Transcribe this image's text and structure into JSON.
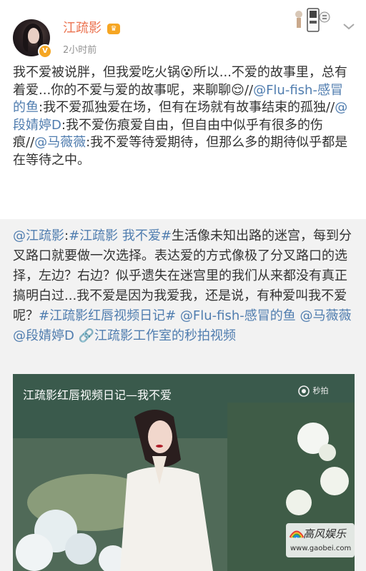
{
  "post": {
    "username": "江疏影",
    "timestamp": "2小时前",
    "text_parts": [
      {
        "t": "我不爱被说胖，但我爱吃火锅",
        "link": false
      },
      {
        "t": "😵",
        "link": false
      },
      {
        "t": "所以...不爱的故事里，总有着爱...你的不爱与爱的故事呢，来聊聊",
        "link": false
      },
      {
        "t": "😌",
        "link": false
      },
      {
        "t": "//",
        "link": false
      },
      {
        "t": "@Flu-fish-感冒的鱼",
        "link": true
      },
      {
        "t": ":我不爱孤独爱在场，但有在场就有故事结束的孤独//",
        "link": false
      },
      {
        "t": "@段婧婷D",
        "link": true
      },
      {
        "t": ":我不爱伤痕爱自由，但自由中似乎有很多的伤痕//",
        "link": false
      },
      {
        "t": "@马薇薇",
        "link": true
      },
      {
        "t": ":我不爱等待爱期待，但那么多的期待似乎都是在等待之中。",
        "link": false
      }
    ]
  },
  "repost": {
    "text_parts": [
      {
        "t": "@江疏影",
        "link": true
      },
      {
        "t": ":",
        "link": false
      },
      {
        "t": "#江疏影 我不爱#",
        "link": true
      },
      {
        "t": "生活像未知出路的迷宫，每到分叉路口就要做一次选择。表达爱的方式像极了分叉路口的选择，左边？右边？似乎遗失在迷宫里的我们从来都没有真正搞明白过...我不爱是因为我爱我，还是说，有种爱叫我不爱呢？",
        "link": false
      },
      {
        "t": "#江疏影红唇视频日记#",
        "link": true
      },
      {
        "t": " ",
        "link": false
      },
      {
        "t": "@Flu-fish-感冒的鱼",
        "link": true
      },
      {
        "t": " ",
        "link": false
      },
      {
        "t": "@马薇薇",
        "link": true
      },
      {
        "t": " ",
        "link": false
      },
      {
        "t": "@段婧婷D",
        "link": true
      },
      {
        "t": " ",
        "link": false
      },
      {
        "t": "🔗江疏影工作室的秒拍视频",
        "link": true
      }
    ]
  },
  "video": {
    "title": "江疏影红唇视频日记—我不爱",
    "watermark": "秒拍",
    "brand_text": "高风娱乐",
    "brand_url": "www.gaobei.com"
  },
  "colors": {
    "username": "#eb7350",
    "link": "#507daf",
    "text": "#333333",
    "repost_bg": "#f2f2f2",
    "timestamp": "#939393"
  },
  "icons": {
    "avatar_badge": "verified-v-icon",
    "vip": "vip-badge-icon",
    "menu": "chevron-down-icon",
    "video_watermark": "camera-icon"
  }
}
